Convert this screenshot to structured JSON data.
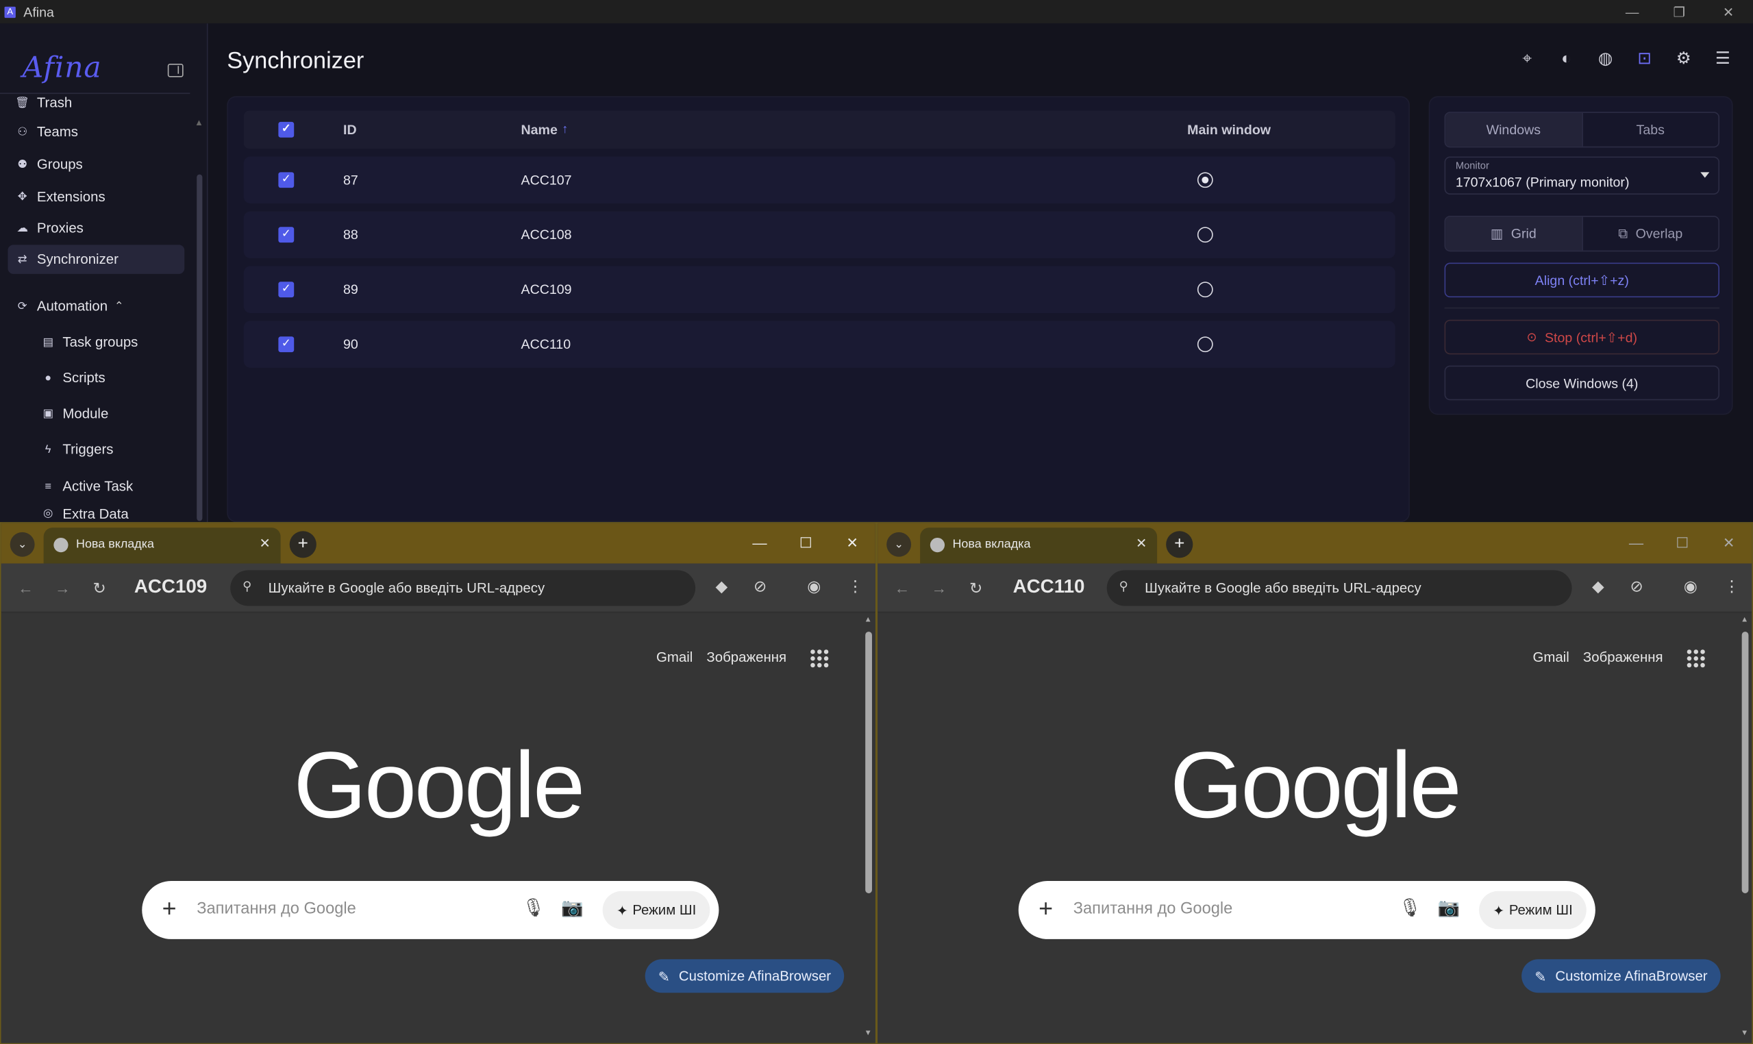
{
  "app": {
    "title": "Afina",
    "brand": "Afina"
  },
  "window_controls": {
    "minimize": "—",
    "restore": "❐",
    "close": "✕"
  },
  "sidebar": {
    "items": [
      {
        "label": "Trash",
        "icon": "trash-icon"
      },
      {
        "label": "Teams",
        "icon": "team-icon"
      },
      {
        "label": "Groups",
        "icon": "groups-icon"
      },
      {
        "label": "Extensions",
        "icon": "puzzle-icon"
      },
      {
        "label": "Proxies",
        "icon": "cloud-icon"
      },
      {
        "label": "Synchronizer",
        "icon": "sync-icon",
        "active": true
      },
      {
        "label": "Automation",
        "icon": "automation-icon",
        "expanded": true
      }
    ],
    "sub_items": [
      {
        "label": "Task groups",
        "icon": "table-icon"
      },
      {
        "label": "Scripts",
        "icon": "github-icon"
      },
      {
        "label": "Module",
        "icon": "terminal-icon"
      },
      {
        "label": "Triggers",
        "icon": "bolt-icon"
      },
      {
        "label": "Active Task",
        "icon": "tasklist-icon"
      },
      {
        "label": "Extra Data",
        "icon": "data-icon"
      }
    ]
  },
  "main": {
    "title": "Synchronizer",
    "top_icons": [
      "tag-icon",
      "fingerprint-icon",
      "globe-icon",
      "robot-icon",
      "gear-icon",
      "layout-icon"
    ],
    "table": {
      "headers": {
        "id": "ID",
        "name": "Name",
        "sort": "↑",
        "main_window": "Main window"
      },
      "rows": [
        {
          "id": "87",
          "name": "ACC107",
          "checked": true,
          "main": true
        },
        {
          "id": "88",
          "name": "ACC108",
          "checked": true,
          "main": false
        },
        {
          "id": "89",
          "name": "ACC109",
          "checked": true,
          "main": false
        },
        {
          "id": "90",
          "name": "ACC110",
          "checked": true,
          "main": false
        }
      ]
    },
    "controls": {
      "tab_windows": "Windows",
      "tab_tabs": "Tabs",
      "monitor_label": "Monitor",
      "monitor_value": "1707x1067 (Primary monitor)",
      "grid_label": "Grid",
      "overlap_label": "Overlap",
      "align_label": "Align (ctrl+⇧+z)",
      "stop_label": "Stop (ctrl+⇧+d)",
      "close_label": "Close Windows (4)"
    }
  },
  "browsers": [
    {
      "tab_title": "Нова вкладка",
      "profile": "ACC109",
      "omnibox": "Шукайте в Google або введіть URL-адресу",
      "links": {
        "gmail": "Gmail",
        "images": "Зображення"
      },
      "logo": "Google",
      "search_placeholder": "Запитання до Google",
      "ai_mode": "Режим ШІ",
      "customize": "Customize AfinaBrowser"
    },
    {
      "tab_title": "Нова вкладка",
      "profile": "ACC110",
      "omnibox": "Шукайте в Google або введіть URL-адресу",
      "links": {
        "gmail": "Gmail",
        "images": "Зображення"
      },
      "logo": "Google",
      "search_placeholder": "Запитання до Google",
      "ai_mode": "Режим ШІ",
      "customize": "Customize AfinaBrowser"
    }
  ]
}
